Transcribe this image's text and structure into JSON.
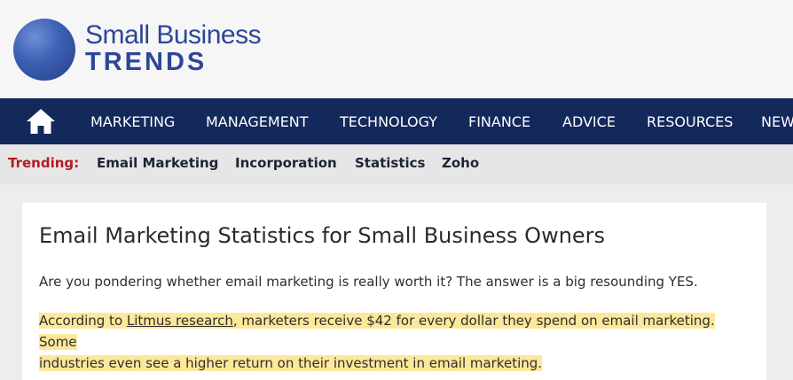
{
  "brand": {
    "name_line1": "Small Business",
    "name_line2": "TRENDS"
  },
  "nav": {
    "home_icon": "home-icon",
    "items": [
      "MARKETING",
      "MANAGEMENT",
      "TECHNOLOGY",
      "FINANCE",
      "ADVICE",
      "RESOURCES",
      "NEWS"
    ]
  },
  "trending": {
    "label": "Trending:",
    "links": [
      "Email Marketing",
      "Incorporation",
      "Statistics",
      "Zoho"
    ]
  },
  "article": {
    "title": "Email Marketing Statistics for Small Business Owners",
    "intro": "Are you pondering whether email marketing is really worth it? The answer is a big resounding YES.",
    "highlight_before": "According to ",
    "highlight_link": "Litmus research",
    "highlight_line1_after": ", marketers receive $42 for every dollar they spend on email marketing. Some",
    "highlight_line2": "industries even see a higher return on their investment in email marketing."
  },
  "colors": {
    "navbar": "#13285b",
    "brand_blue": "#2d4797",
    "trending_red": "#b31b24",
    "highlight": "#fde79a"
  }
}
